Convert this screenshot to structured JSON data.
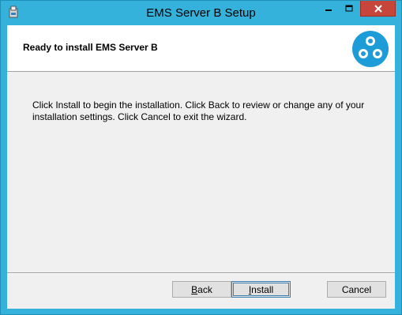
{
  "window": {
    "title": "EMS Server B Setup"
  },
  "banner": {
    "title": "Ready to install EMS Server B"
  },
  "body": {
    "message": "Click Install to begin the installation. Click Back to review or change any of your installation settings. Click Cancel to exit the wizard."
  },
  "buttons": {
    "back": {
      "mnemonic": "B",
      "rest": "ack"
    },
    "install": {
      "mnemonic": "I",
      "rest": "nstall"
    },
    "cancel": "Cancel"
  },
  "icons": {
    "app": "installer-icon",
    "logo": "product-logo-icon",
    "minimize": "minimize-icon",
    "maximize": "maximize-icon",
    "close": "close-icon"
  },
  "colors": {
    "title_bar": "#34b2dc",
    "close_button": "#c7463b",
    "logo": "#1e9cd7"
  }
}
